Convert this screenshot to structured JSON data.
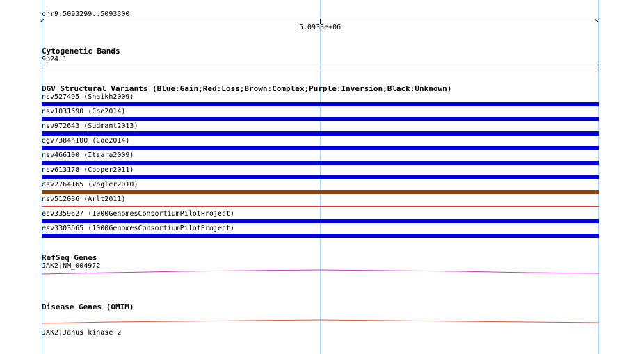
{
  "ruler": {
    "locus": "chr9:5093299..5093300",
    "center_tick": "5.0933e+06"
  },
  "cyto": {
    "title": "Cytogenetic Bands",
    "band": "9p24.1"
  },
  "dgv": {
    "title": "DGV Structural Variants (Blue:Gain;Red:Loss;Brown:Complex;Purple:Inversion;Black:Unknown)",
    "variants": [
      {
        "label": "nsv527495 (Shaikh2009)",
        "color": "#0000dd"
      },
      {
        "label": "nsv1031690 (Coe2014)",
        "color": "#0000dd"
      },
      {
        "label": "nsv972643 (Sudmant2013)",
        "color": "#0000dd"
      },
      {
        "label": "dgv7384n100 (Coe2014)",
        "color": "#0000dd"
      },
      {
        "label": "nsv466100 (Itsara2009)",
        "color": "#0000dd"
      },
      {
        "label": "nsv613178 (Cooper2011)",
        "color": "#0000dd"
      },
      {
        "label": "esv2764165 (Vogler2010)",
        "color": "#8b4513"
      },
      {
        "label": "nsv512086 (Arlt2011)",
        "color": "#dd3333"
      },
      {
        "label": "esv3359627 (1000GenomesConsortiumPilotProject)",
        "color": "#0000dd"
      },
      {
        "label": "esv3303665 (1000GenomesConsortiumPilotProject)",
        "color": "#0000dd"
      }
    ]
  },
  "refseq": {
    "title": "RefSeq Genes",
    "gene": "JAK2|NM_004972",
    "color": "#cc33cc"
  },
  "omim": {
    "title": "Disease Genes (OMIM)",
    "gene": "JAK2|Janus kinase 2",
    "color": "#e0553a"
  }
}
